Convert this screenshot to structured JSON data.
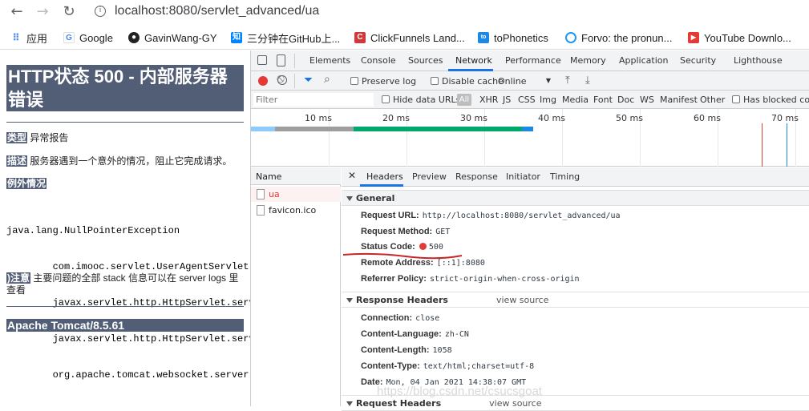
{
  "browser": {
    "url": "localhost:8080/servlet_advanced/ua",
    "bookmarks": [
      {
        "label": "应用",
        "icon": "apps-grid-icon"
      },
      {
        "label": "Google",
        "icon": "google-icon"
      },
      {
        "label": "GavinWang-GY",
        "icon": "github-icon"
      },
      {
        "label": "三分钟在GitHub上...",
        "icon": "zhihu-icon"
      },
      {
        "label": "ClickFunnels Land...",
        "icon": "clickfunnels-icon"
      },
      {
        "label": "toPhonetics",
        "icon": "tophonetics-icon"
      },
      {
        "label": "Forvo: the pronun...",
        "icon": "forvo-icon"
      },
      {
        "label": "YouTube Downlo...",
        "icon": "youtube-icon"
      }
    ]
  },
  "page": {
    "title_line1": "HTTP状态 500 - 内部服务器",
    "title_line2": "错误",
    "type_label": "类型",
    "type_value": "异常报告",
    "desc_label": "描述",
    "desc_value": "服务器遇到一个意外的情况，阻止它完成请求。",
    "exception_label": "例外情况",
    "stack": [
      "java.lang.NullPointerException",
      "        com.imooc.servlet.UserAgentServlet.d",
      "        javax.servlet.http.HttpServlet.servi",
      "        javax.servlet.http.HttpServlet.servi",
      "        org.apache.tomcat.websocket.server.W"
    ],
    "note_label": ")注意",
    "note_value_1": "主要问题的全部 stack 信息可以在 server logs 里",
    "note_value_2": "查看",
    "footer": "Apache Tomcat/8.5.61"
  },
  "devtools": {
    "tabs": [
      "Elements",
      "Console",
      "Sources",
      "Network",
      "Performance",
      "Memory",
      "Application",
      "Security",
      "Lighthouse"
    ],
    "active_tab": "Network",
    "toolbar": {
      "preserve_log": "Preserve log",
      "disable_cache": "Disable cache",
      "throttle": "Online"
    },
    "filter": {
      "placeholder": "Filter",
      "hide_data_urls": "Hide data URLs",
      "all": "All",
      "types": [
        "XHR",
        "JS",
        "CSS",
        "Img",
        "Media",
        "Font",
        "Doc",
        "WS",
        "Manifest",
        "Other"
      ],
      "blocked_cookies": "Has blocked cookies"
    },
    "timeline_ticks": [
      "10 ms",
      "20 ms",
      "30 ms",
      "40 ms",
      "50 ms",
      "60 ms",
      "70 ms"
    ],
    "requests": {
      "column": "Name",
      "rows": [
        "ua",
        "favicon.ico"
      ]
    },
    "detail_tabs": [
      "Headers",
      "Preview",
      "Response",
      "Initiator",
      "Timing"
    ],
    "general": {
      "title": "General",
      "request_url_k": "Request URL:",
      "request_url_v": "http://localhost:8080/servlet_advanced/ua",
      "request_method_k": "Request Method:",
      "request_method_v": "GET",
      "status_code_k": "Status Code:",
      "status_code_v": "500",
      "remote_address_k": "Remote Address:",
      "remote_address_v": "[::1]:8080",
      "referrer_policy_k": "Referrer Policy:",
      "referrer_policy_v": "strict-origin-when-cross-origin"
    },
    "response_headers": {
      "title": "Response Headers",
      "view_source": "view source",
      "connection_k": "Connection:",
      "connection_v": "close",
      "content_language_k": "Content-Language:",
      "content_language_v": "zh-CN",
      "content_length_k": "Content-Length:",
      "content_length_v": "1058",
      "content_type_k": "Content-Type:",
      "content_type_v": "text/html;charset=utf-8",
      "date_k": "Date:",
      "date_v": "Mon, 04 Jan 2021 14:38:07 GMT"
    },
    "request_headers": {
      "title": "Request Headers",
      "view_source": "view source"
    }
  },
  "watermark": "https://blog.csdn.net/csucsgoat",
  "colors": {
    "tomcat_header": "#525d76",
    "devtools_accent": "#1a73e8",
    "error_red": "#e53935"
  }
}
